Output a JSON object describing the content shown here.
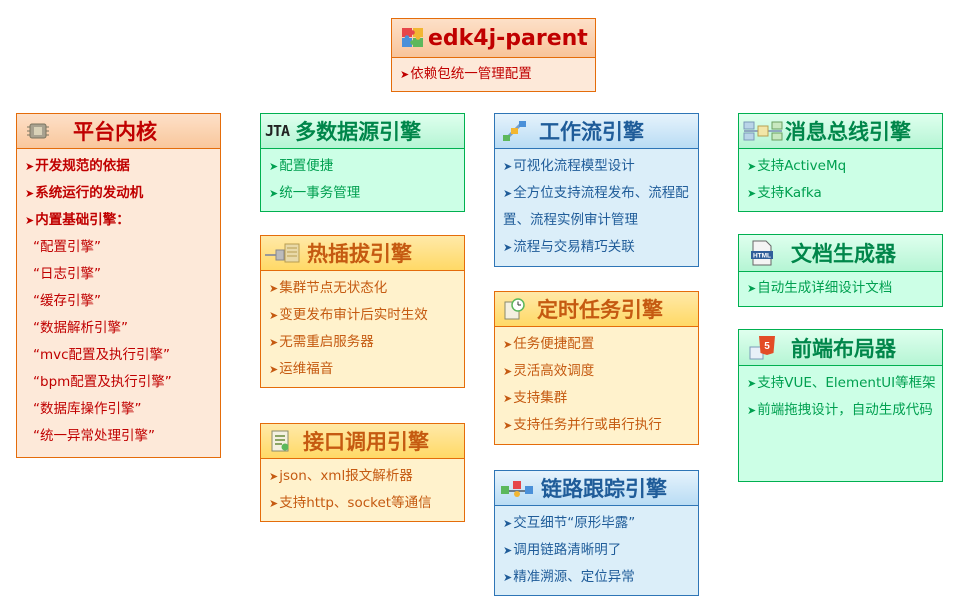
{
  "parent": {
    "title": "edk4j-parent",
    "items": [
      "依赖包统一管理配置"
    ]
  },
  "core": {
    "title": "平台内核",
    "items": [
      "开发规范的依据",
      "系统运行的发动机",
      "内置基础引擎："
    ],
    "subitems": [
      "“配置引擎”",
      "“日志引擎”",
      "“缓存引擎”",
      "“数据解析引擎”",
      "“mvc配置及执行引擎”",
      "“bpm配置及执行引擎”",
      "“数据库操作引擎”",
      "“统一异常处理引擎”"
    ]
  },
  "datasource": {
    "logo": "JTA",
    "title": "多数据源引擎",
    "items": [
      "配置便捷",
      "统一事务管理"
    ]
  },
  "hotplug": {
    "title": "热插拔引擎",
    "items": [
      "集群节点无状态化",
      "变更发布审计后实时生效",
      "无需重启服务器",
      "运维福音"
    ]
  },
  "api": {
    "title": "接口调用引擎",
    "items": [
      "json、xml报文解析器",
      "支持http、socket等通信"
    ]
  },
  "workflow": {
    "title": "工作流引擎",
    "items": [
      "可视化流程模型设计",
      "全方位支持流程发布、流程配置、流程实例审计管理",
      "流程与交易精巧关联"
    ]
  },
  "timer": {
    "title": "定时任务引擎",
    "items": [
      "任务便捷配置",
      "灵活高效调度",
      "支持集群",
      "支持任务并行或串行执行"
    ]
  },
  "trace": {
    "title": "链路跟踪引擎",
    "items": [
      "交互细节“原形毕露”",
      "调用链路清晰明了",
      "精准溯源、定位异常"
    ]
  },
  "mq": {
    "title": "消息总线引擎",
    "items": [
      "支持ActiveMq",
      "支持Kafka"
    ]
  },
  "doc": {
    "icon_text": "HTML",
    "title": "文档生成器",
    "items": [
      "自动生成详细设计文档"
    ]
  },
  "frontend": {
    "icon_text": "5",
    "title": "前端布局器",
    "items": [
      "支持VUE、ElementUI等框架",
      "前端拖拽设计，自动生成代码"
    ]
  },
  "icons": {
    "parent": "puzzle-icon",
    "core": "cpu-chip-icon",
    "hotplug": "plug-icon",
    "api": "document-icon",
    "workflow": "workflow-icon",
    "timer": "clock-icon",
    "trace": "network-icon",
    "mq": "message-bus-icon",
    "doc": "html-file-icon",
    "frontend": "html5-icon"
  },
  "colors": {
    "orange": "#e46c0a",
    "red_text": "#c00000",
    "green": "#00b050",
    "blue": "#2e75b6",
    "yellow": "#ffd966"
  }
}
